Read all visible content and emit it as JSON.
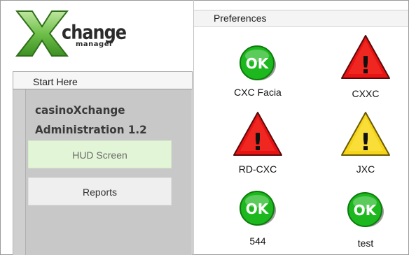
{
  "app": {
    "logo_big_letter": "X",
    "logo_word": "change",
    "logo_sub": "manager"
  },
  "sidebar": {
    "section_label": "Start Here",
    "title_line1": "casinoXchange",
    "title_line2": "Administration 1.2",
    "buttons": [
      {
        "label": "HUD Screen",
        "state": "active"
      },
      {
        "label": "Reports",
        "state": "normal"
      }
    ]
  },
  "preferences": {
    "header": "Preferences",
    "items": [
      {
        "label": "CXC Facia",
        "status": "ok",
        "icon_text": "OK"
      },
      {
        "label": "CXXC",
        "status": "error",
        "icon_text": "!"
      },
      {
        "label": "RD-CXC",
        "status": "error",
        "icon_text": "!"
      },
      {
        "label": "JXC",
        "status": "warning",
        "icon_text": "!"
      },
      {
        "label": "544",
        "status": "ok",
        "icon_text": "OK"
      },
      {
        "label": "test",
        "status": "ok",
        "icon_text": "OK"
      }
    ]
  },
  "colors": {
    "ok_green": "#1db81d",
    "error_red": "#e81414",
    "warning_yellow": "#f6d418",
    "logo_green": "#6fc04a",
    "hud_active_bg": "#e2f5d6"
  }
}
